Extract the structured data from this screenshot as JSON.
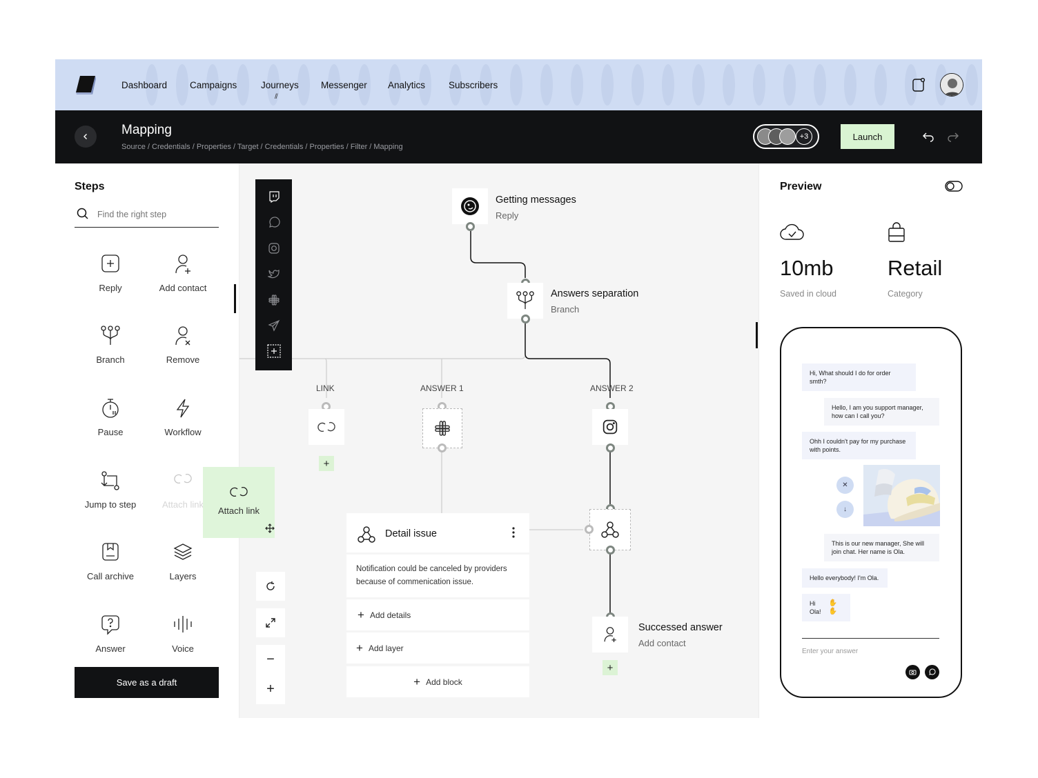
{
  "nav": {
    "items": [
      "Dashboard",
      "Campaigns",
      "Journeys",
      "Messenger",
      "Analytics",
      "Subscribers"
    ],
    "active_marker": "//",
    "icons": {
      "logo": "cube-logo",
      "device": "phone-notification-icon",
      "avatar": "user-avatar"
    }
  },
  "header": {
    "title": "Mapping",
    "breadcrumb": "Source / Credentials / Properties / Target / Credentials / Properties / Filter / Mapping",
    "team_more": "+3",
    "launch": "Launch"
  },
  "steps": {
    "title": "Steps",
    "search_placeholder": "Find the right step",
    "items": [
      {
        "label": "Reply",
        "icon": "reply-icon"
      },
      {
        "label": "Add contact",
        "icon": "add-contact-icon"
      },
      {
        "label": "Branch",
        "icon": "branch-icon"
      },
      {
        "label": "Remove",
        "icon": "remove-contact-icon"
      },
      {
        "label": "Pause",
        "icon": "timer-icon"
      },
      {
        "label": "Workflow",
        "icon": "lightning-icon"
      },
      {
        "label": "Jump to step",
        "icon": "jump-icon"
      },
      {
        "label": "Attach link",
        "icon": "link-icon"
      },
      {
        "label": "Call archive",
        "icon": "archive-icon"
      },
      {
        "label": "Layers",
        "icon": "layers-icon"
      },
      {
        "label": "Answer",
        "icon": "question-icon"
      },
      {
        "label": "Voice",
        "icon": "voice-icon"
      }
    ],
    "dragging_label": "Attach link",
    "save_draft": "Save as a draft"
  },
  "canvas": {
    "channels": [
      "twitch-icon",
      "whatsapp-icon",
      "instagram-icon",
      "twitter-icon",
      "slack-icon",
      "send-icon",
      "add-channel-icon"
    ],
    "nodes": {
      "getting_messages": {
        "title": "Getting messages",
        "subtitle": "Reply"
      },
      "answers_separation": {
        "title": "Answers separation",
        "subtitle": "Branch"
      },
      "successed_answer": {
        "title": "Successed answer",
        "subtitle": "Add contact"
      }
    },
    "branches": [
      "LINK",
      "ANSWER 1",
      "ANSWER 2"
    ],
    "detail": {
      "title": "Detail issue",
      "body": "Notification could be canceled by providers because of commenication issue.",
      "add_details": "Add details",
      "add_layer": "Add layer",
      "add_block": "Add block"
    },
    "plus": "+",
    "zoom_out": "−",
    "zoom_in": "+"
  },
  "preview": {
    "title": "Preview",
    "stats": [
      {
        "value": "10mb",
        "label": "Saved in cloud",
        "icon": "cloud-check-icon"
      },
      {
        "value": "Retail",
        "label": "Category",
        "icon": "shopping-bag-icon"
      }
    ],
    "messages": [
      "Hi, What should I do for order smth?",
      "Hello, I am you support manager, how can I call you?",
      "Ohh I couldn't pay for my purchase with points.",
      "This is our new manager, She will join chat. Her name is Ola.",
      "Hello everybody! I'm Ola.",
      "Hi Ola!"
    ],
    "input_placeholder": "Enter your answer"
  },
  "colors": {
    "accent_green": "#d9f4d2",
    "nav_blue": "#cfdcf3",
    "dark": "#111214"
  }
}
